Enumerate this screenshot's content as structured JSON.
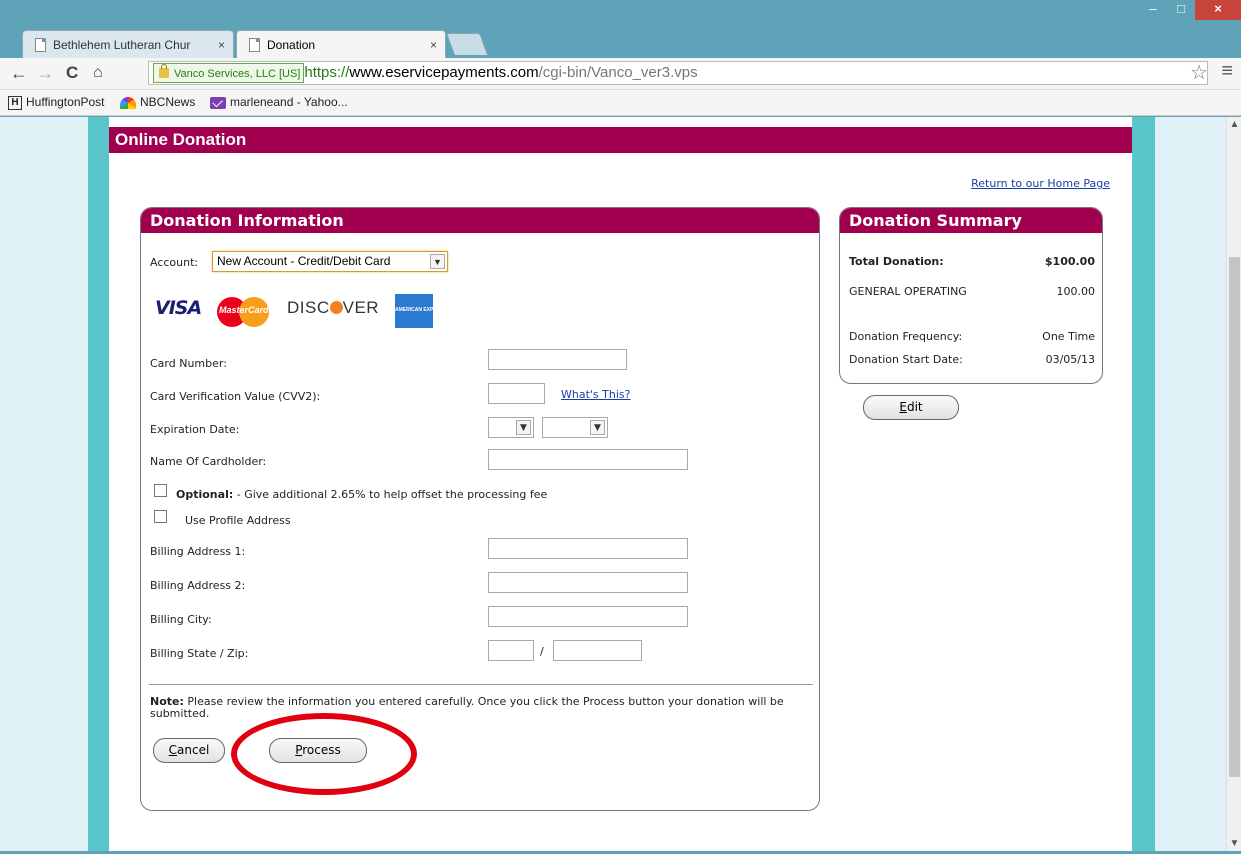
{
  "browser": {
    "tabs": [
      {
        "label": "Bethlehem Lutheran Chur",
        "active": false
      },
      {
        "label": "Donation",
        "active": true
      }
    ],
    "tab_close_glyph": "×",
    "window_controls": [
      "–",
      "□",
      "×"
    ],
    "ev_badge": "Vanco Services, LLC [US]",
    "url": {
      "scheme": "https://",
      "host": "www.eservicepayments.com",
      "path": "/cgi-bin/Vanco_ver3.vps"
    },
    "bookmarks": [
      {
        "label": "HuffingtonPost",
        "icon": "huffington-icon"
      },
      {
        "label": "NBCNews",
        "icon": "nbc-peacock-icon"
      },
      {
        "label": "marleneand - Yahoo...",
        "icon": "mail-icon"
      }
    ]
  },
  "page": {
    "banner_title": "Online Donation",
    "return_link": "Return to our Home Page"
  },
  "donation_info": {
    "title": "Donation Information",
    "account_label": "Account:",
    "account_value": "New Account - Credit/Debit Card",
    "card_brands": {
      "visa": "VISA",
      "mastercard": "MasterCard",
      "discover_pre": "DISC",
      "discover_post": "VER",
      "amex": "AMERICAN EXPRESS"
    },
    "card_number_label": "Card Number:",
    "cvv_label": "Card Verification Value (CVV2):",
    "whats_this": "What's This?",
    "expiration_label": "Expiration Date:",
    "cardholder_label": "Name Of Cardholder:",
    "optional_bold": "Optional:",
    "optional_text": " - Give additional 2.65% to help offset the processing fee",
    "use_profile_label": "Use Profile Address",
    "billing1_label": "Billing Address 1:",
    "billing2_label": "Billing Address 2:",
    "city_label": "Billing City:",
    "state_zip_label": "Billing State / Zip:",
    "state_zip_sep": "/",
    "note_bold": "Note:",
    "note_text": " Please review the information you entered carefully. Once you click the Process button your donation will be submitted.",
    "cancel_hotkey": "C",
    "cancel_rest": "ancel",
    "process_hotkey": "P",
    "process_rest": "rocess"
  },
  "summary": {
    "title": "Donation Summary",
    "total_label": "Total Donation:",
    "total_value": "$100.00",
    "fund_label": "GENERAL OPERATING",
    "fund_value": "100.00",
    "frequency_label": "Donation Frequency:",
    "frequency_value": "One Time",
    "start_label": "Donation Start Date:",
    "start_value": "03/05/13",
    "edit_hotkey": "E",
    "edit_rest": "dit"
  },
  "colors": {
    "banner": "#a0004d",
    "frame": "#5bc5cc",
    "annotation": "#e0000f"
  }
}
